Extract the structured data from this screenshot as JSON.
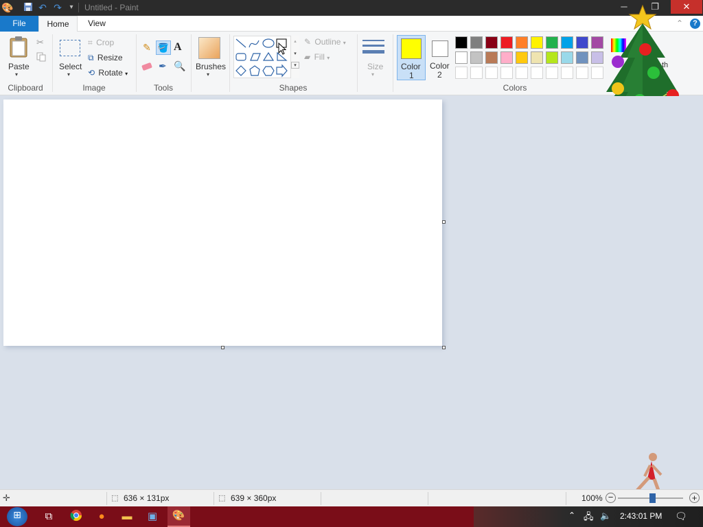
{
  "window": {
    "title": "Untitled - Paint",
    "minimize_icon": "minimize-icon",
    "maximize_icon": "restore-icon",
    "close_icon": "close-icon"
  },
  "quick_access": {
    "items": [
      "paint-app-icon",
      "save-icon",
      "undo-icon",
      "redo-icon",
      "customize-icon"
    ]
  },
  "tabs": {
    "file": "File",
    "home": "Home",
    "view": "View"
  },
  "ribbon": {
    "clipboard": {
      "label": "Clipboard",
      "paste": "Paste"
    },
    "image": {
      "label": "Image",
      "select": "Select",
      "crop": "Crop",
      "resize": "Resize",
      "rotate": "Rotate"
    },
    "tools": {
      "label": "Tools"
    },
    "brushes": {
      "label": "Brushes"
    },
    "shapes": {
      "label": "Shapes",
      "outline": "Outline",
      "fill": "Fill"
    },
    "size": {
      "label": "Size"
    },
    "colors": {
      "label": "Colors",
      "color1": "Color",
      "color1_num": "1",
      "color2": "Color",
      "color2_num": "2",
      "edit_partial": "th",
      "color1_value": "#ffff00",
      "color2_value": "#ffffff",
      "row1": [
        "#000000",
        "#7f7f7f",
        "#880015",
        "#ed1c24",
        "#ff7f27",
        "#fff200",
        "#22b14c",
        "#00a2e8",
        "#3f48cc",
        "#a349a4"
      ],
      "row2": [
        "#ffffff",
        "#c3c3c3",
        "#b97a57",
        "#ffaec9",
        "#ffc90e",
        "#efe4b0",
        "#b5e61d",
        "#99d9ea",
        "#7092be",
        "#c8bfe7"
      ]
    }
  },
  "status": {
    "selection_size": "636 × 131px",
    "image_size": "639 × 360px",
    "zoom": "100%"
  },
  "taskbar": {
    "clock": "2:43:01 PM"
  }
}
